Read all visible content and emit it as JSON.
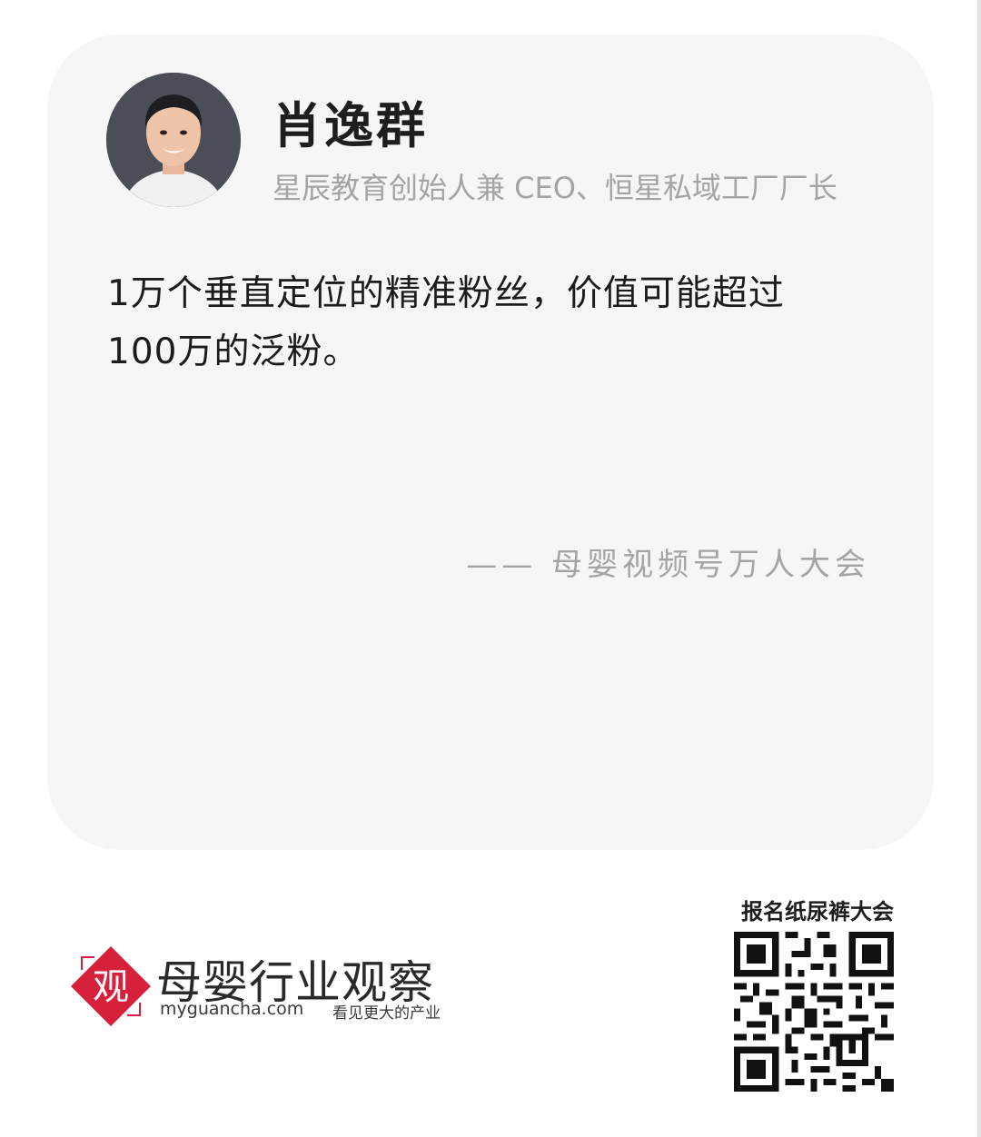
{
  "speaker": {
    "name": "肖逸群",
    "title": "星辰教育创始人兼 CEO、恒星私域工厂厂长",
    "avatar_icon": "person-avatar-photo"
  },
  "quote": {
    "line1": "1万个垂直定位的精准粉丝，价值可能超过",
    "line2": "100万的泛粉。"
  },
  "source": "—— 母婴视频号万人大会",
  "footer": {
    "logo_mark_text": "观",
    "brand_name": "母婴行业观察",
    "domain": "myguancha.com",
    "slogan": "看见更大的产业",
    "qr_label": "报名纸尿裤大会",
    "qr_icon": "qr-code-icon"
  },
  "colors": {
    "card_background": "#f6f6f6",
    "brand_red": "#d7213a",
    "secondary_text": "#a4a4a4",
    "primary_text": "#1c1c1c"
  }
}
